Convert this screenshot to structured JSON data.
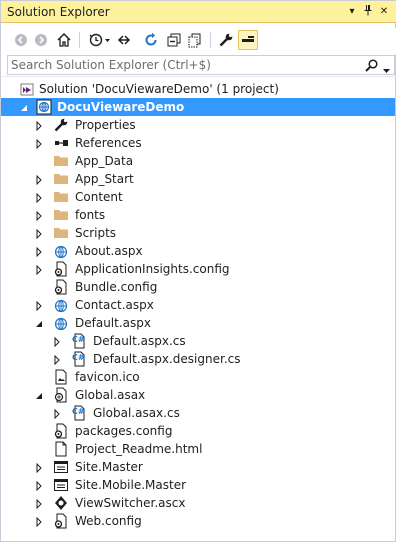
{
  "window": {
    "title": "Solution Explorer",
    "dropdown_glyph": "▾",
    "pin_glyph": "⊥",
    "close_glyph": "✕"
  },
  "toolbar": {
    "items": [
      "back-icon",
      "forward-icon",
      "home-icon",
      "pending-changes-icon",
      "sync-icon",
      "refresh-icon",
      "collapse-all-icon",
      "show-all-files-icon",
      "properties-icon",
      "preview-icon"
    ]
  },
  "search": {
    "placeholder": "Search Solution Explorer (Ctrl+$)"
  },
  "tree": {
    "solution": "Solution 'DocuViewareDemo' (1 project)",
    "project": "DocuViewareDemo",
    "items": [
      {
        "label": "Properties",
        "icon": "wrench-icon"
      },
      {
        "label": "References",
        "icon": "references-icon"
      },
      {
        "label": "App_Data",
        "icon": "folder-icon"
      },
      {
        "label": "App_Start",
        "icon": "folder-icon"
      },
      {
        "label": "Content",
        "icon": "folder-icon"
      },
      {
        "label": "fonts",
        "icon": "folder-icon"
      },
      {
        "label": "Scripts",
        "icon": "folder-icon"
      },
      {
        "label": "About.aspx",
        "icon": "aspx-page-icon"
      },
      {
        "label": "ApplicationInsights.config",
        "icon": "config-file-icon"
      },
      {
        "label": "Bundle.config",
        "icon": "config-file-icon"
      },
      {
        "label": "Contact.aspx",
        "icon": "aspx-page-icon"
      },
      {
        "label": "Default.aspx",
        "icon": "aspx-page-icon"
      },
      {
        "label": "Default.aspx.cs",
        "icon": "cs-file-icon"
      },
      {
        "label": "Default.aspx.designer.cs",
        "icon": "cs-file-icon"
      },
      {
        "label": "favicon.ico",
        "icon": "image-file-icon"
      },
      {
        "label": "Global.asax",
        "icon": "asax-file-icon"
      },
      {
        "label": "Global.asax.cs",
        "icon": "cs-file-icon"
      },
      {
        "label": "packages.config",
        "icon": "config-file-icon"
      },
      {
        "label": "Project_Readme.html",
        "icon": "html-file-icon"
      },
      {
        "label": "Site.Master",
        "icon": "master-page-icon"
      },
      {
        "label": "Site.Mobile.Master",
        "icon": "master-page-icon"
      },
      {
        "label": "ViewSwitcher.ascx",
        "icon": "user-control-icon"
      },
      {
        "label": "Web.config",
        "icon": "config-file-icon"
      }
    ]
  },
  "colors": {
    "titlebar_bg": "#fff29d",
    "selection": "#3399ff",
    "folder": "#dcb67a",
    "cs_blue": "#1e75c9"
  }
}
